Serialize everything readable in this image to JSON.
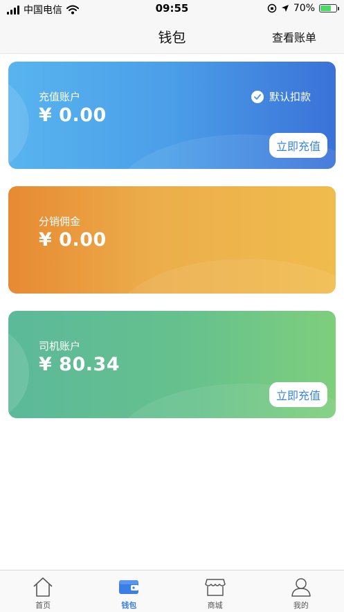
{
  "status_bar": {
    "carrier": "中国电信",
    "time": "09:55",
    "battery_percent": "70%",
    "battery_level": 0.7
  },
  "nav": {
    "title": "钱包",
    "action": "查看账单"
  },
  "cards": [
    {
      "label": "充值账户",
      "amount": "¥ 0.00",
      "autopay_label": "默认扣款",
      "button_label": "立即充值"
    },
    {
      "label": "分销佣金",
      "amount": "¥ 0.00"
    },
    {
      "label": "司机账户",
      "amount": "¥ 80.34",
      "button_label": "立即充值"
    }
  ],
  "tabs": [
    {
      "label": "首页",
      "icon": "home-icon"
    },
    {
      "label": "钱包",
      "icon": "wallet-icon",
      "active": true
    },
    {
      "label": "商城",
      "icon": "store-icon"
    },
    {
      "label": "我的",
      "icon": "user-icon"
    }
  ],
  "colors": {
    "accent": "#3b7ee6",
    "card_blue": "#4b9ee8",
    "card_orange": "#ecae4b",
    "card_green": "#66c18d"
  }
}
